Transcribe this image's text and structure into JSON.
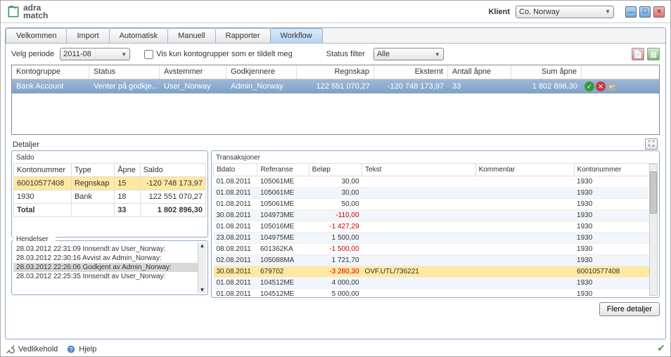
{
  "header": {
    "logo_top": "adra",
    "logo_bottom": "match",
    "klient_label": "Klient",
    "klient_value": "Co. Norway"
  },
  "tabs": {
    "t0": "Velkommen",
    "t1": "Import",
    "t2": "Automatisk",
    "t3": "Manuell",
    "t4": "Rapporter",
    "t5": "Workflow"
  },
  "toolbar": {
    "velg_periode": "Velg periode",
    "period_value": "2011-08",
    "vis_kun": "Vis kun kontogrupper som er tildelt meg",
    "status_filter_label": "Status filter",
    "status_filter_value": "Alle"
  },
  "grid": {
    "h_kontogruppe": "Kontogruppe",
    "h_status": "Status",
    "h_avstemmer": "Avstemmer",
    "h_godkjenner": "Godkjennere",
    "h_regnskap": "Regnskap",
    "h_eksternt": "Eksternt",
    "h_antall": "Antall åpne",
    "h_sum": "Sum åpne",
    "r_kontogruppe": "Bank Account",
    "r_status": "Venter på godkje...",
    "r_avstemmer": "User_Norway",
    "r_godkjenner": "Admin_Norway",
    "r_regnskap": "122 551 070,27",
    "r_eksternt": "-120 748 173,97",
    "r_antall": "33",
    "r_sum": "1 802 896,30"
  },
  "details_label": "Detaljer",
  "saldo": {
    "label": "Saldo",
    "h_konto": "Kontonummer",
    "h_type": "Type",
    "h_apne": "Åpne",
    "h_saldo": "Saldo",
    "r1_konto": "60010577408",
    "r1_type": "Regnskap",
    "r1_apne": "15",
    "r1_saldo": "-120 748 173,97",
    "r2_konto": "1930",
    "r2_type": "Bank",
    "r2_apne": "18",
    "r2_saldo": "122 551 070,27",
    "r3_konto": "Total",
    "r3_type": "",
    "r3_apne": "33",
    "r3_saldo": "1 802 896,30"
  },
  "hendelser": {
    "label": "Hendelser",
    "e0": "28.03.2012 22:31:09 Innsendt av User_Norway:",
    "e1": "28.03.2012 22:30:16 Avvist av Admin_Norway:",
    "e2": "28.03.2012 22:26:06 Godkjent av Admin_Norway:",
    "e3": "28.03.2012 22:25:35 Innsendt av User_Norway:"
  },
  "trans": {
    "label": "Transaksjoner",
    "h_bdato": "Bdato",
    "h_ref": "Referanse",
    "h_belop": "Beløp",
    "h_tekst": "Tekst",
    "h_kom": "Kommentar",
    "h_konto": "Kontonummer",
    "rows": [
      {
        "bd": "01.08.2011",
        "rf": "105061ME",
        "bl": "30,00",
        "neg": false,
        "tk": "",
        "km": "",
        "kn": "1930"
      },
      {
        "bd": "01.08.2011",
        "rf": "105061ME",
        "bl": "30,00",
        "neg": false,
        "tk": "",
        "km": "",
        "kn": "1930"
      },
      {
        "bd": "01.08.2011",
        "rf": "105061ME",
        "bl": "50,00",
        "neg": false,
        "tk": "",
        "km": "",
        "kn": "1930"
      },
      {
        "bd": "30.08.2011",
        "rf": "104973ME",
        "bl": "-110,00",
        "neg": true,
        "tk": "",
        "km": "",
        "kn": "1930"
      },
      {
        "bd": "01.08.2011",
        "rf": "105016ME",
        "bl": "-1 427,29",
        "neg": true,
        "tk": "",
        "km": "",
        "kn": "1930"
      },
      {
        "bd": "23.08.2011",
        "rf": "104975ME",
        "bl": "1 500,00",
        "neg": false,
        "tk": "",
        "km": "",
        "kn": "1930"
      },
      {
        "bd": "08.08.2011",
        "rf": "601362KA",
        "bl": "-1 500,00",
        "neg": true,
        "tk": "",
        "km": "",
        "kn": "1930"
      },
      {
        "bd": "02.08.2011",
        "rf": "105088MA",
        "bl": "1 721,70",
        "neg": false,
        "tk": "",
        "km": "",
        "kn": "1930"
      },
      {
        "bd": "30.08.2011",
        "rf": "679702",
        "bl": "-3 280,30",
        "neg": true,
        "tk": "OVF.UTL/736221",
        "km": "",
        "kn": "60010577408"
      },
      {
        "bd": "01.08.2011",
        "rf": "104512ME",
        "bl": "4 000,00",
        "neg": false,
        "tk": "",
        "km": "",
        "kn": "1930"
      },
      {
        "bd": "01.08.2011",
        "rf": "104512ME",
        "bl": "5 000,00",
        "neg": false,
        "tk": "",
        "km": "",
        "kn": "1930"
      }
    ]
  },
  "bottom": {
    "flere": "Flere detaljer"
  },
  "footer": {
    "vedlikehold": "Vedlikehold",
    "hjelp": "Hjelp"
  }
}
